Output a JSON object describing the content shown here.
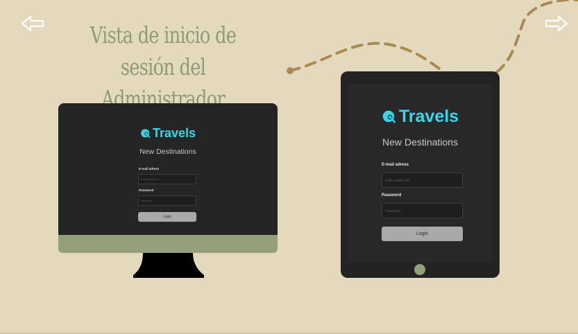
{
  "slide": {
    "title": "Vista de inicio de sesión del Administrador",
    "nav": {
      "back_icon": "arrow-left-icon",
      "forward_icon": "arrow-right-icon"
    }
  },
  "login": {
    "brand": "Travels",
    "subtitle": "New Destinations",
    "email_label": "E-mail adress",
    "email_placeholder": "Enter email here",
    "password_label": "Password",
    "password_placeholder": "Password",
    "login_button": "Login"
  },
  "colors": {
    "background": "#e5d9bd",
    "title": "#8c9c76",
    "brand": "#3ad6e8",
    "path": "#a98a52",
    "device_accent": "#949f7c"
  }
}
